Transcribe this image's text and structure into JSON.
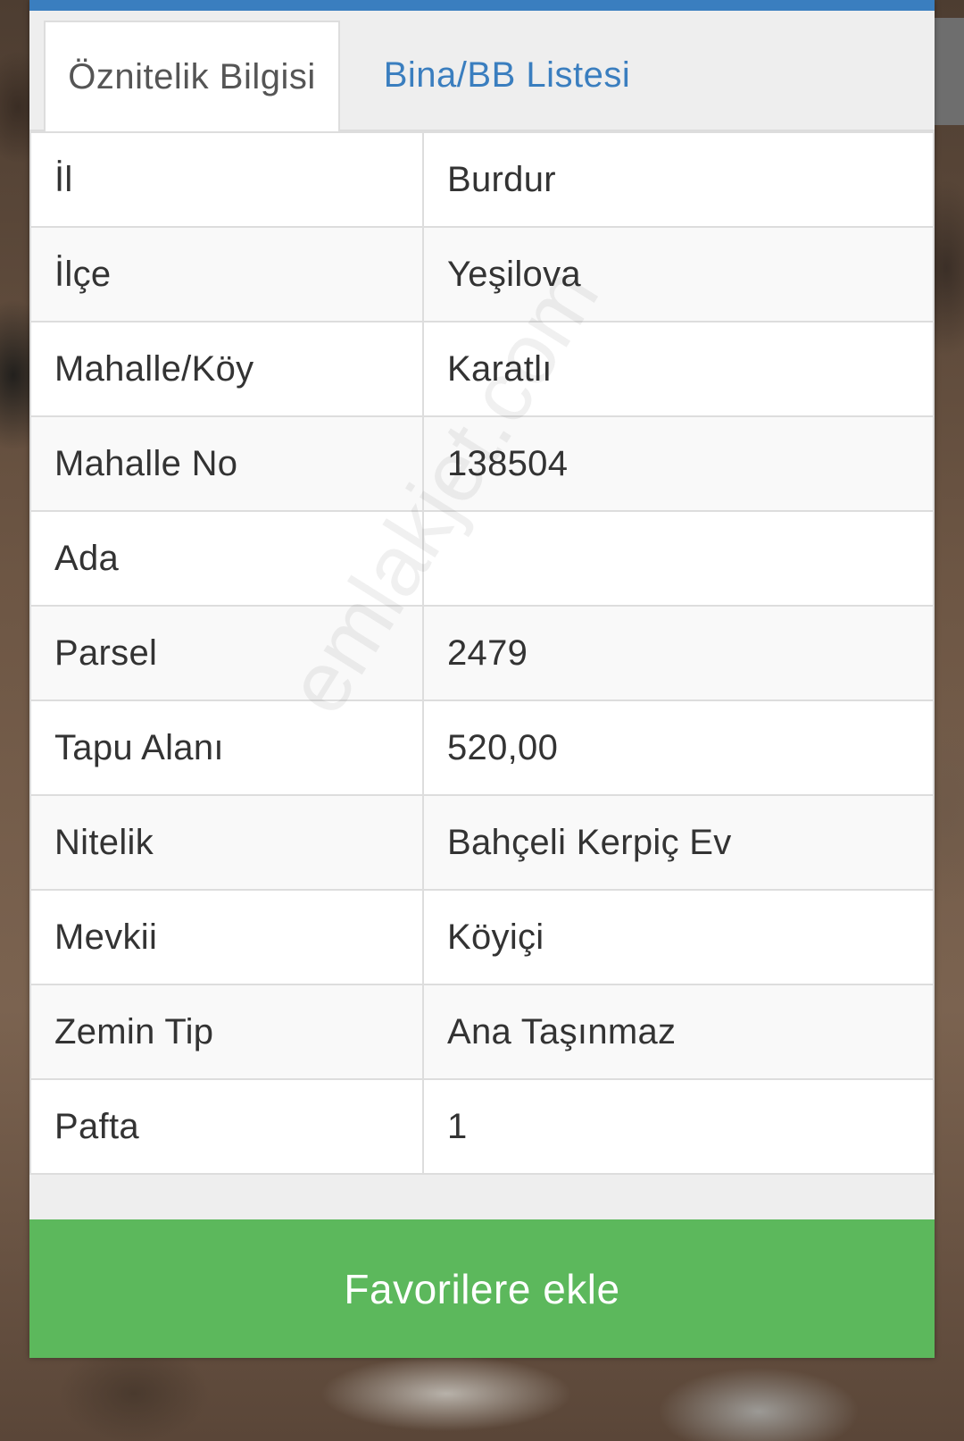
{
  "tabs": [
    {
      "label": "Öznitelik Bilgisi",
      "active": true
    },
    {
      "label": "Bina/BB Listesi",
      "active": false
    }
  ],
  "rows": [
    {
      "key": "İl",
      "value": "Burdur"
    },
    {
      "key": "İlçe",
      "value": "Yeşilova"
    },
    {
      "key": "Mahalle/Köy",
      "value": "Karatlı"
    },
    {
      "key": "Mahalle No",
      "value": "138504"
    },
    {
      "key": "Ada",
      "value": ""
    },
    {
      "key": "Parsel",
      "value": "2479"
    },
    {
      "key": "Tapu Alanı",
      "value": "520,00"
    },
    {
      "key": "Nitelik",
      "value": "Bahçeli Kerpiç Ev"
    },
    {
      "key": "Mevkii",
      "value": "Köyiçi"
    },
    {
      "key": "Zemin Tip",
      "value": "Ana Taşınmaz"
    },
    {
      "key": "Pafta",
      "value": "1"
    }
  ],
  "favorite_button": "Favorilere ekle",
  "watermark": "emlakjet.com",
  "colors": {
    "accent": "#3a7ebf",
    "button": "#5cb85c"
  }
}
